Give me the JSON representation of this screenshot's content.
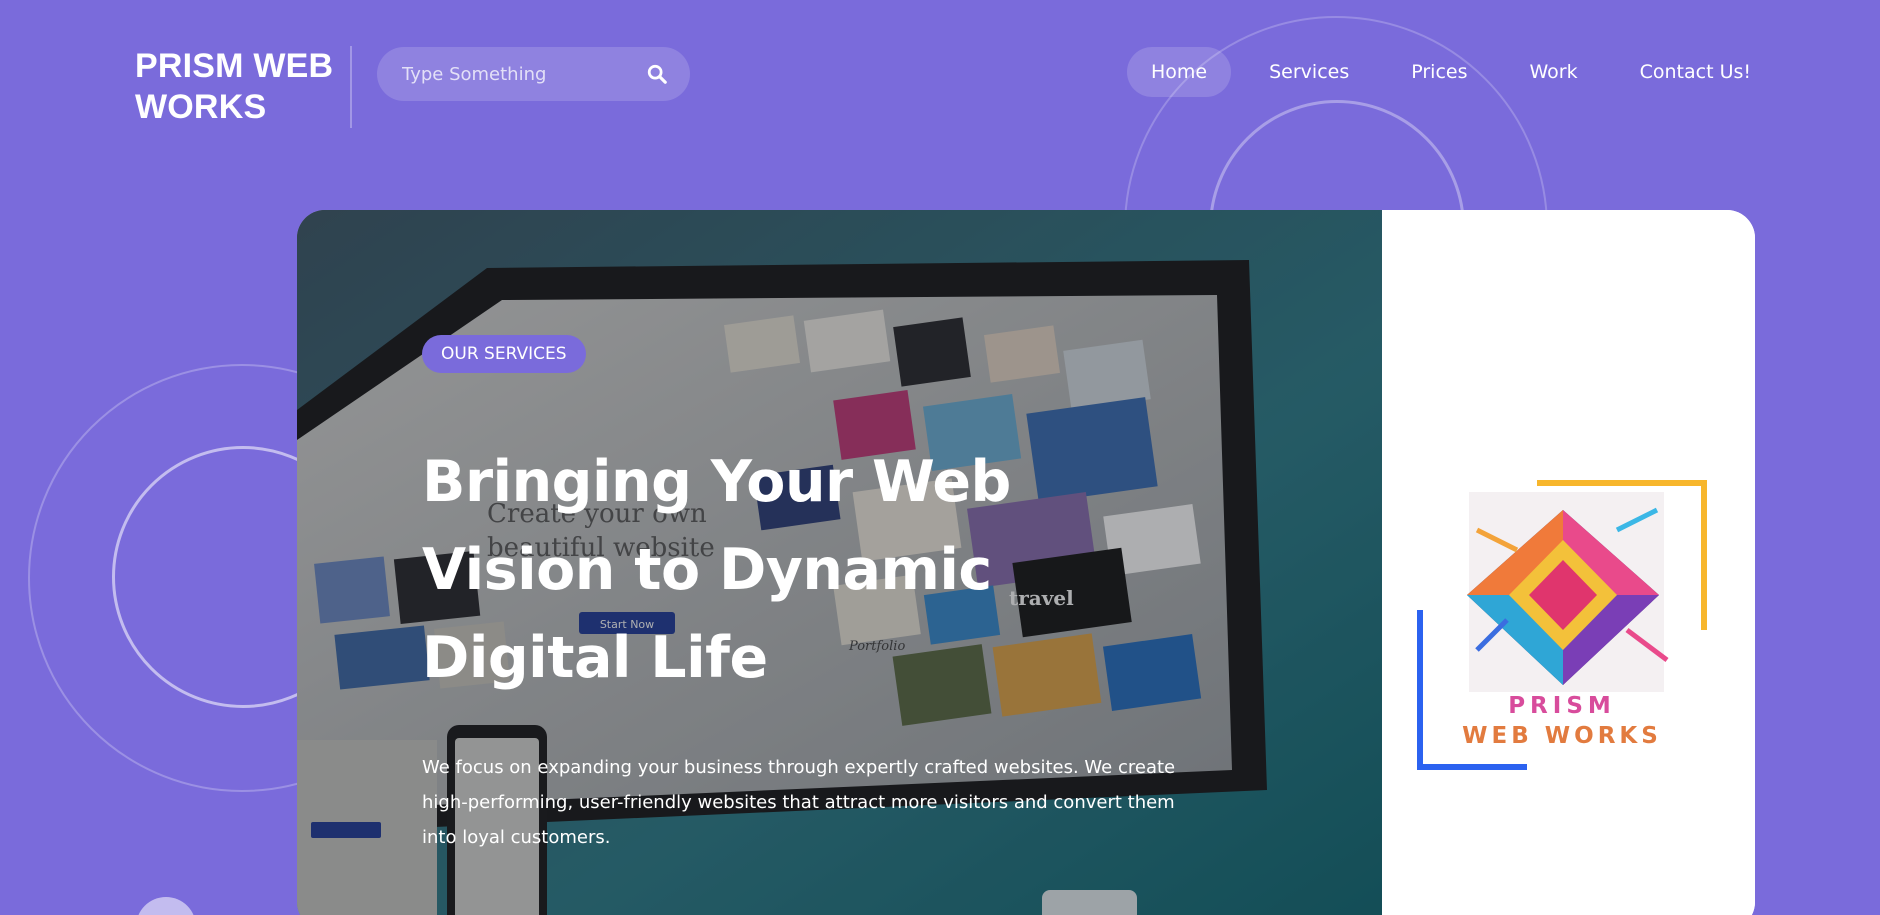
{
  "header": {
    "logo_line1": "PRISM WEB",
    "logo_line2": "WORKS",
    "search": {
      "placeholder": "Type Something",
      "icon": "search-icon"
    }
  },
  "nav": {
    "items": [
      {
        "label": "Home",
        "active": true
      },
      {
        "label": "Services",
        "active": false
      },
      {
        "label": "Prices",
        "active": false
      },
      {
        "label": "Work",
        "active": false
      },
      {
        "label": "Contact Us!",
        "active": false
      }
    ]
  },
  "hero": {
    "badge": "OUR SERVICES",
    "headline": "Bringing Your Web Vision to Dynamic Digital Life",
    "subtext": "We focus on expanding your business through expertly crafted websites. We create high-performing, user-friendly websites that attract more visitors and convert them into loyal customers.",
    "image_text": {
      "create1": "Create your own",
      "create2": "beautiful website",
      "start_now": "Start Now",
      "travel": "travel",
      "portfolio": "Portfolio"
    }
  },
  "brand_logo": {
    "line1": "PRISM",
    "line2": "WEB WORKS"
  },
  "colors": {
    "background": "#7a6bdb",
    "accent": "#7a6bdb",
    "card": "#ffffff"
  }
}
